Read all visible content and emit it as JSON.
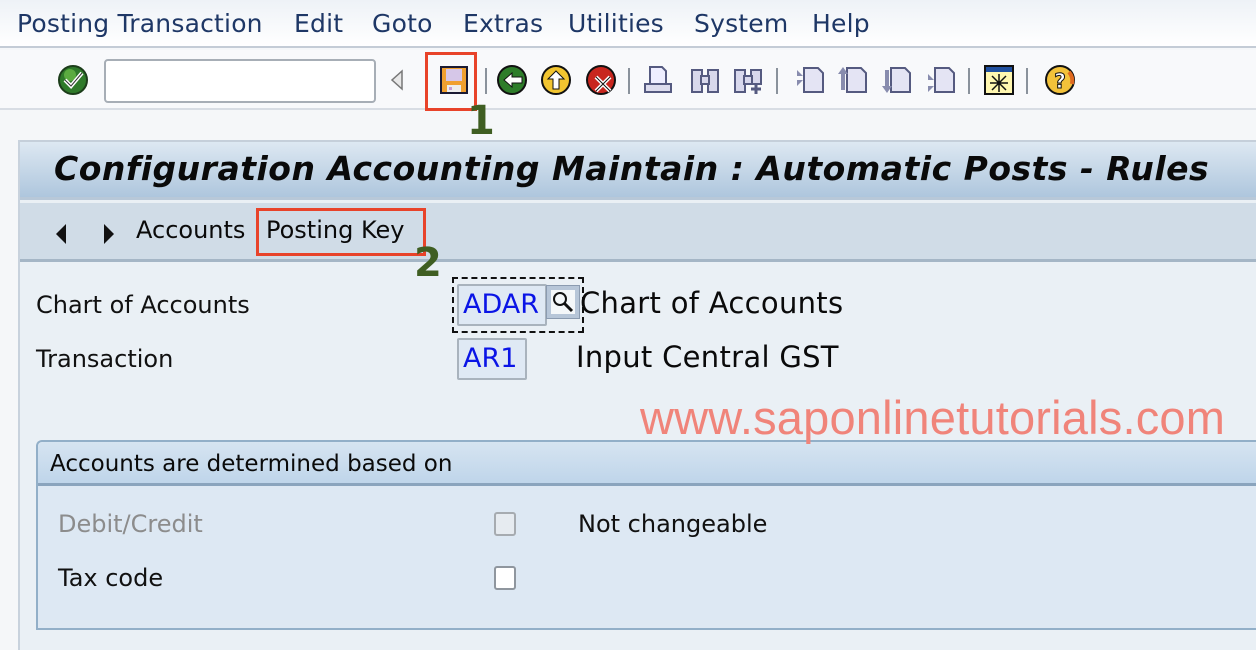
{
  "menu": {
    "items": [
      "Posting Transaction",
      "Edit",
      "Goto",
      "Extras",
      "Utilities",
      "System",
      "Help"
    ]
  },
  "toolbar": {
    "command_field_value": "",
    "icons": [
      "enter-check",
      "back-triangle",
      "save",
      "back",
      "exit",
      "cancel",
      "print",
      "find",
      "find-next",
      "first-page",
      "previous-page",
      "next-page",
      "last-page",
      "create-session",
      "help"
    ]
  },
  "annotations": {
    "step1": "1",
    "step2": "2"
  },
  "window": {
    "title": "Configuration Accounting Maintain : Automatic Posts - Rules",
    "nav": {
      "links": [
        "Accounts",
        "Posting Key"
      ]
    }
  },
  "fields": {
    "chart_of_accounts": {
      "label": "Chart of Accounts",
      "value": "ADAR",
      "description": "Chart of Accounts"
    },
    "transaction": {
      "label": "Transaction",
      "value": "AR1",
      "description": "Input Central GST"
    }
  },
  "watermark": "www.saponlinetutorials.com",
  "group": {
    "title": "Accounts are determined based on",
    "rows": [
      {
        "label": "Debit/Credit",
        "checked": false,
        "disabled": true,
        "note": "Not changeable"
      },
      {
        "label": "Tax code",
        "checked": false,
        "disabled": false,
        "note": ""
      }
    ]
  },
  "colors": {
    "highlight": "#e8432a",
    "step_number": "#3f5e22",
    "field_value": "#0a14e6",
    "watermark": "#f0847a",
    "menu_text": "#1e3766"
  }
}
